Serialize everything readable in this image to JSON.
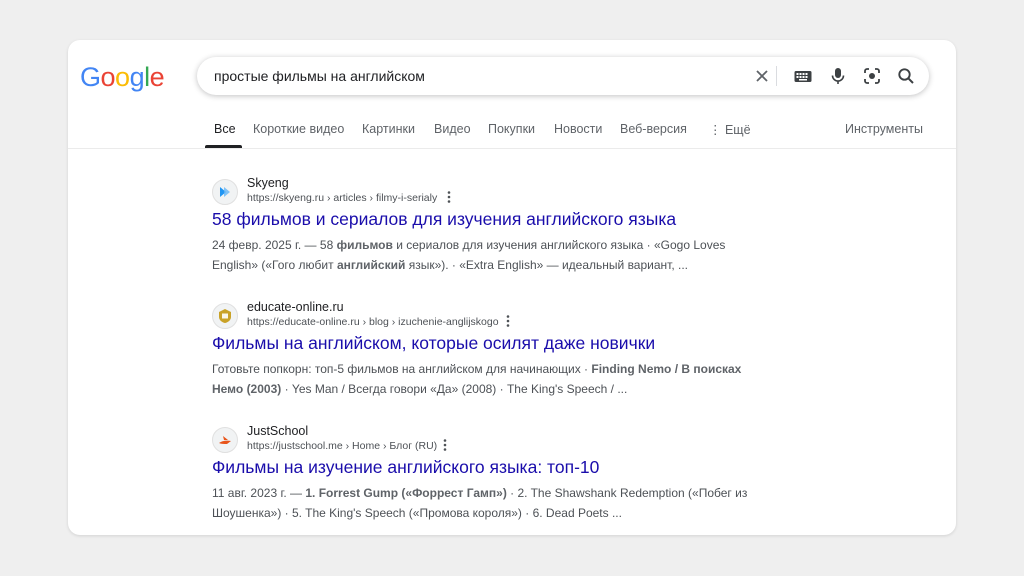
{
  "logo": {
    "text": "Google"
  },
  "search": {
    "query": "простые фильмы на английском"
  },
  "tabs": [
    {
      "label": "Все"
    },
    {
      "label": "Короткие видео"
    },
    {
      "label": "Картинки"
    },
    {
      "label": "Видео"
    },
    {
      "label": "Покупки"
    },
    {
      "label": "Новости"
    },
    {
      "label": "Веб-версия"
    },
    {
      "label": "⋮ Ещё"
    }
  ],
  "tools": {
    "label": "Инструменты"
  },
  "results": [
    {
      "site": "Skyeng",
      "url": "https://skyeng.ru › articles › filmy-i-serialy",
      "title": "58 фильмов и сериалов для изучения английского языка",
      "snippet_line1": {
        "date": "24 февр. 2025 г. — 58 ",
        "bold1": "фильмов",
        "rest": " и сериалов для изучения английского языка · «Gogo Loves"
      },
      "snippet_line2": {
        "pre": "English» («Гого любит ",
        "bold": "английский",
        "post": " язык»). · «Extra English» — идеальный вариант, ..."
      },
      "favicon_color": "#2196f3"
    },
    {
      "site": "educate-online.ru",
      "url": "https://educate-online.ru › blog › izuchenie-anglijskogo",
      "title": "Фильмы на английском, которые осилят даже новички",
      "snippet_line1": {
        "pre": "Готовьте попкорн: топ-5 фильмов на английском для начинающих · ",
        "bold": "Finding Nemo / В поисках"
      },
      "snippet_line2": {
        "bold": "Немо (2003)",
        "post": " · Yes Man / Всегда говори «Да» (2008) · The King's Speech / ..."
      },
      "favicon_color": "#c9a227"
    },
    {
      "site": "JustSchool",
      "url": "https://justschool.me › Home › Блог (RU)",
      "title": "Фильмы на изучение английского языка: топ-10",
      "snippet_line1": {
        "pre": "11 авг. 2023 г. — ",
        "bold": "1. Forrest Gump («Форрест Гамп»)",
        "post": " · 2. The Shawshank Redemption («Побег из"
      },
      "snippet_line2": {
        "text": "Шоушенка») · 5. The King's Speech («Промова короля») · 6. Dead Poets ..."
      },
      "favicon_color": "#e8541a"
    }
  ]
}
